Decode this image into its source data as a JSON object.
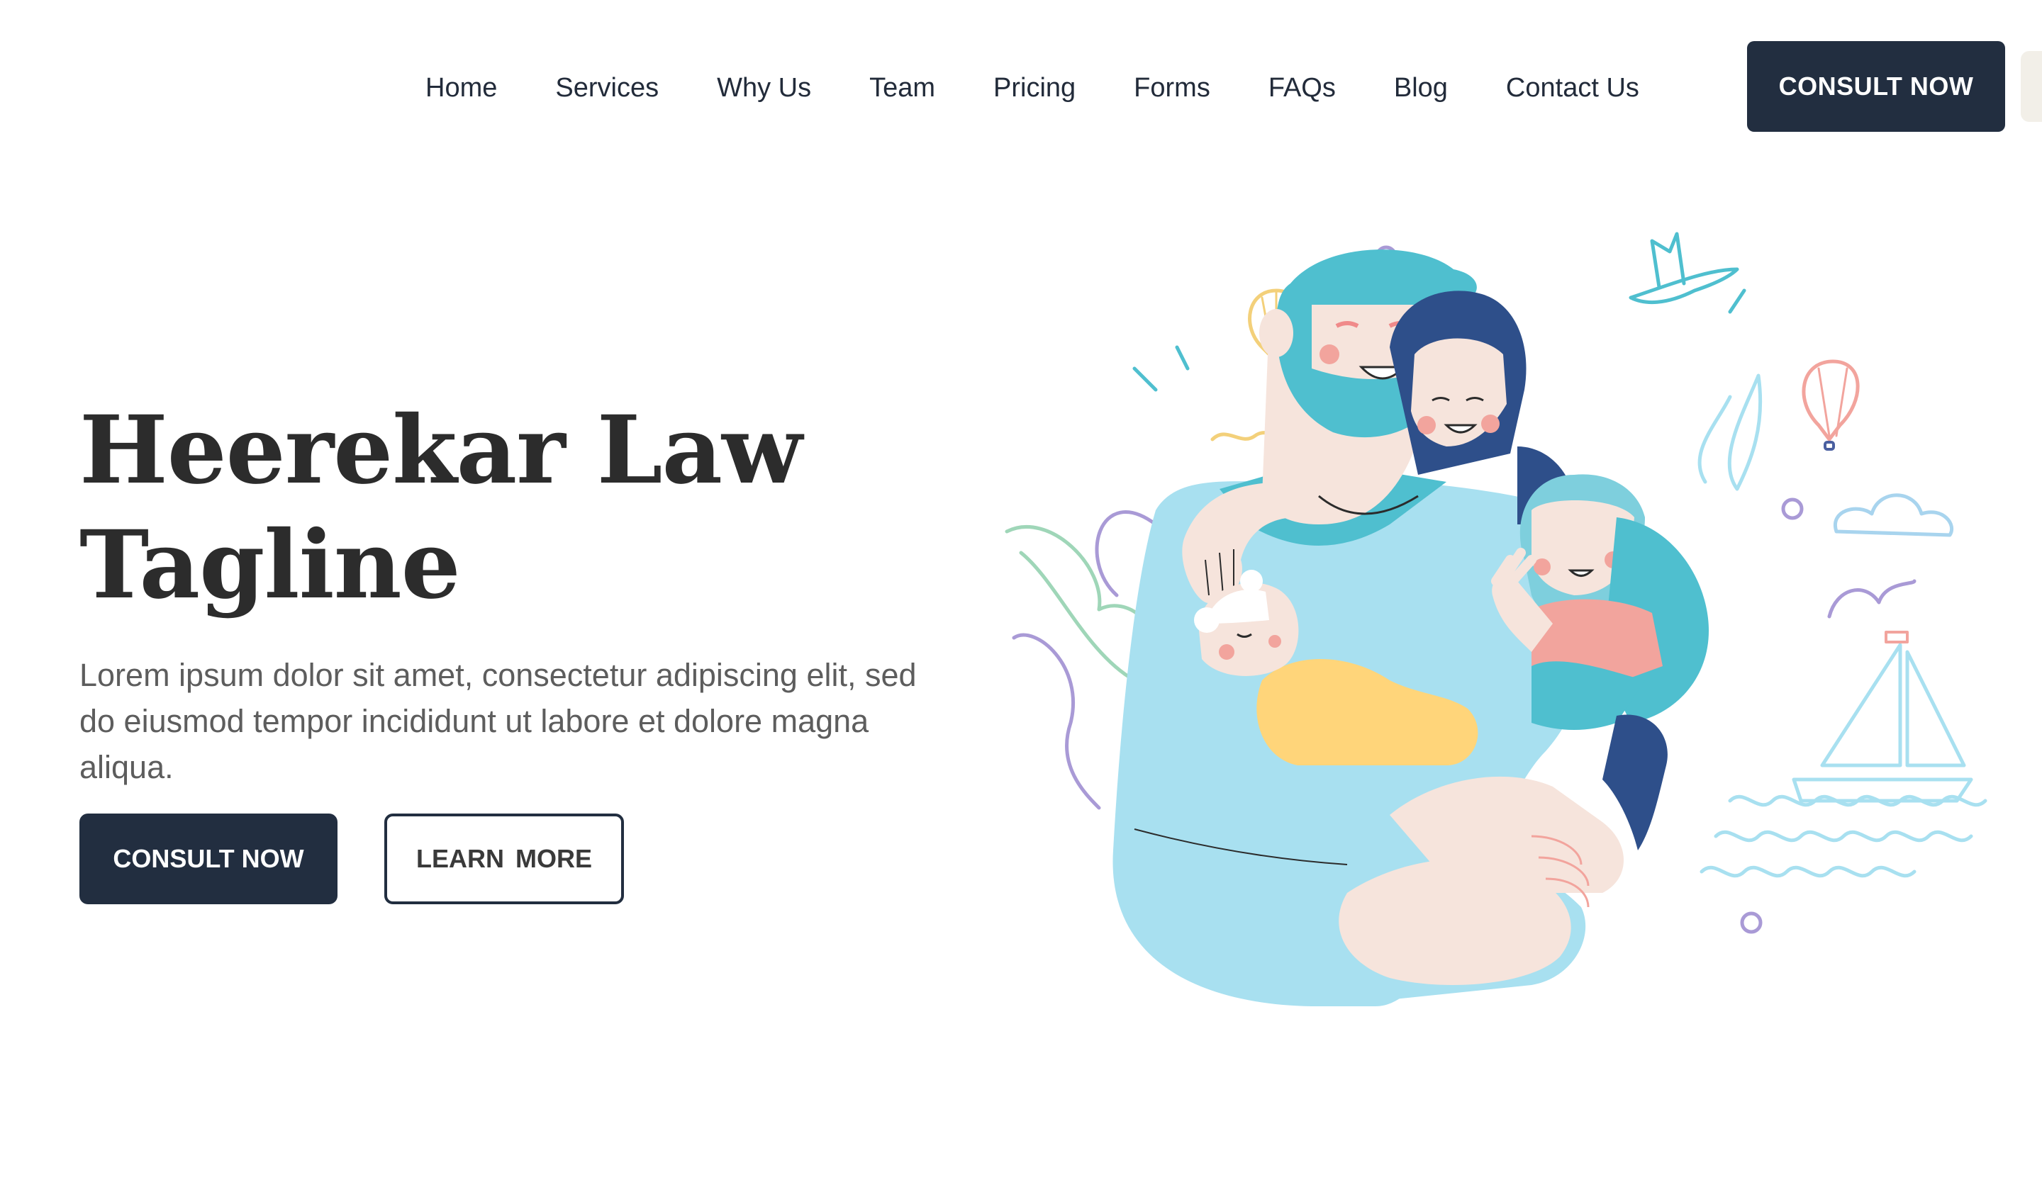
{
  "nav": {
    "links": [
      "Home",
      "Services",
      "Why Us",
      "Team",
      "Pricing",
      "Forms",
      "FAQs",
      "Blog",
      "Contact Us"
    ],
    "cta_label": "CONSULT NOW"
  },
  "hero": {
    "title_line1": "Heerekar Law",
    "title_line2": "Tagline",
    "text": "Lorem ipsum dolor sit amet, consectetur adipiscing elit, sed do eiusmod tempor incididunt ut labore et dolore magna aliqua.",
    "primary_label": "CONSULT NOW",
    "secondary_label": "LEARN  MORE"
  },
  "colors": {
    "brand_dark": "#222e40",
    "teal": "#4fbfcf",
    "light_blue": "#a8e0f0",
    "skin": "#f6e4dc",
    "yellow": "#ffd57a",
    "coral": "#f2a49d",
    "navy_hair": "#2e4f8a"
  },
  "illustration": {
    "icon": "family-illustration"
  }
}
